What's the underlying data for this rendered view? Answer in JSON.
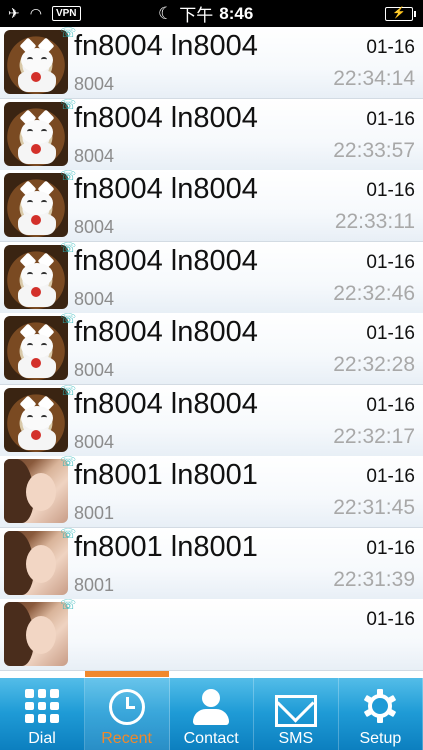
{
  "status_bar": {
    "vpn": "VPN",
    "time_prefix": "下午",
    "time": "8:46"
  },
  "recent_calls": [
    {
      "name": "fn8004 ln8004",
      "number": "8004",
      "date": "01-16",
      "time": "22:34:14",
      "avatar": "cat"
    },
    {
      "name": "fn8004 ln8004",
      "number": "8004",
      "date": "01-16",
      "time": "22:33:57",
      "avatar": "cat"
    },
    {
      "name": "fn8004 ln8004",
      "number": "8004",
      "date": "01-16",
      "time": "22:33:11",
      "avatar": "cat"
    },
    {
      "name": "fn8004 ln8004",
      "number": "8004",
      "date": "01-16",
      "time": "22:32:46",
      "avatar": "cat"
    },
    {
      "name": "fn8004 ln8004",
      "number": "8004",
      "date": "01-16",
      "time": "22:32:28",
      "avatar": "cat"
    },
    {
      "name": "fn8004 ln8004",
      "number": "8004",
      "date": "01-16",
      "time": "22:32:17",
      "avatar": "cat"
    },
    {
      "name": "fn8001 ln8001",
      "number": "8001",
      "date": "01-16",
      "time": "22:31:45",
      "avatar": "girl"
    },
    {
      "name": "fn8001 ln8001",
      "number": "8001",
      "date": "01-16",
      "time": "22:31:39",
      "avatar": "girl"
    },
    {
      "name": "",
      "number": "",
      "date": "01-16",
      "time": "",
      "avatar": "girl"
    }
  ],
  "tabs": [
    {
      "label": "Dial",
      "icon": "dialpad-icon"
    },
    {
      "label": "Recent",
      "icon": "clock-icon",
      "active": true
    },
    {
      "label": "Contact",
      "icon": "person-icon"
    },
    {
      "label": "SMS",
      "icon": "envelope-icon"
    },
    {
      "label": "Setup",
      "icon": "gear-icon"
    }
  ],
  "colors": {
    "tab_bar": "#1f9bd6",
    "active_tab": "#f0882c",
    "call_badge": "#2bb5b8"
  }
}
